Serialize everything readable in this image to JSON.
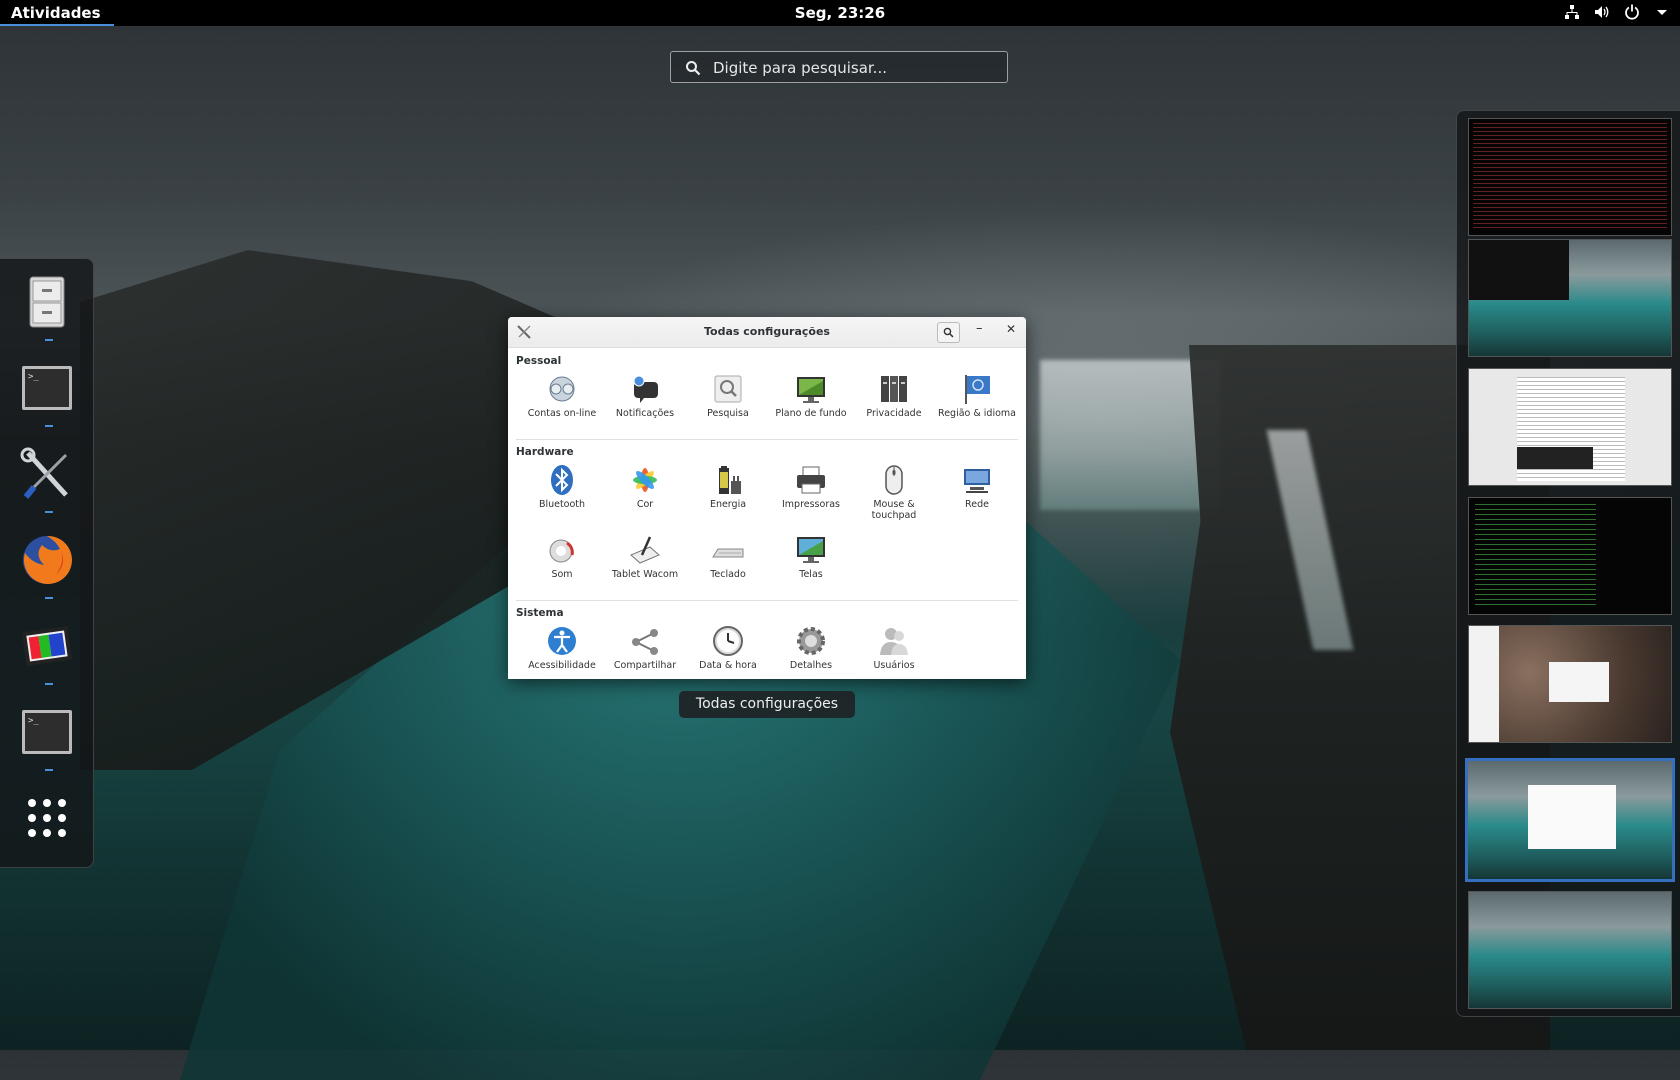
{
  "topbar": {
    "activities": "Atividades",
    "clock": "Seg, 23:26",
    "tray": [
      "network-icon",
      "volume-icon",
      "power-icon",
      "menu-arrow-icon"
    ]
  },
  "search": {
    "placeholder": "Digite para pesquisar..."
  },
  "dash": {
    "items": [
      "files-icon",
      "terminal-icon",
      "tools-icon",
      "firefox-icon",
      "image-viewer-icon",
      "terminal-icon",
      "show-apps-icon"
    ]
  },
  "settings": {
    "title": "Todas configurações",
    "sections": {
      "pessoal": {
        "label": "Pessoal",
        "items": [
          "Contas on-line",
          "Notificações",
          "Pesquisa",
          "Plano de fundo",
          "Privacidade",
          "Região & idioma"
        ]
      },
      "hardware": {
        "label": "Hardware",
        "items": [
          "Bluetooth",
          "Cor",
          "Energia",
          "Impressoras",
          "Mouse & touchpad",
          "Rede",
          "Som",
          "Tablet Wacom",
          "Teclado",
          "Telas"
        ]
      },
      "sistema": {
        "label": "Sistema",
        "items": [
          "Acessibilidade",
          "Compartilhar",
          "Data & hora",
          "Detalhes",
          "Usuários"
        ]
      }
    }
  },
  "tooltip": "Todas configurações",
  "workspaces": {
    "count": 7,
    "active_index": 5
  },
  "colors": {
    "accent": "#4a90d9",
    "panel": "#000000"
  }
}
